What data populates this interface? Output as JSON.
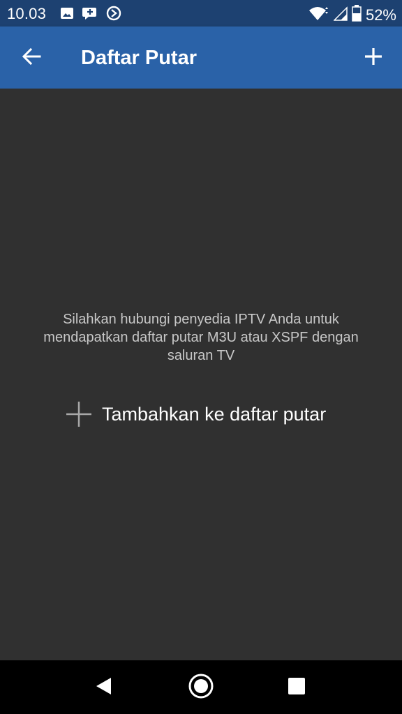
{
  "status_bar": {
    "time": "10.03",
    "battery_percent": "52%",
    "left_icons": [
      "image-icon",
      "chat-bubble-icon",
      "play-circle-icon"
    ],
    "right_icons": [
      "wifi-icon",
      "signal-icon",
      "battery-icon"
    ]
  },
  "app_bar": {
    "title": "Daftar Putar",
    "back_icon": "arrow-left-icon",
    "add_icon": "plus-icon",
    "color": "#2a62a8"
  },
  "content": {
    "message": "Silahkan hubungi penyedia IPTV Anda untuk mendapatkan daftar putar M3U atau XSPF dengan saluran TV",
    "add_playlist_label": "Tambahkan ke daftar putar",
    "background": "#303030"
  },
  "nav_bar": {
    "buttons": [
      "back-triangle-icon",
      "home-circle-icon",
      "recents-square-icon"
    ]
  }
}
